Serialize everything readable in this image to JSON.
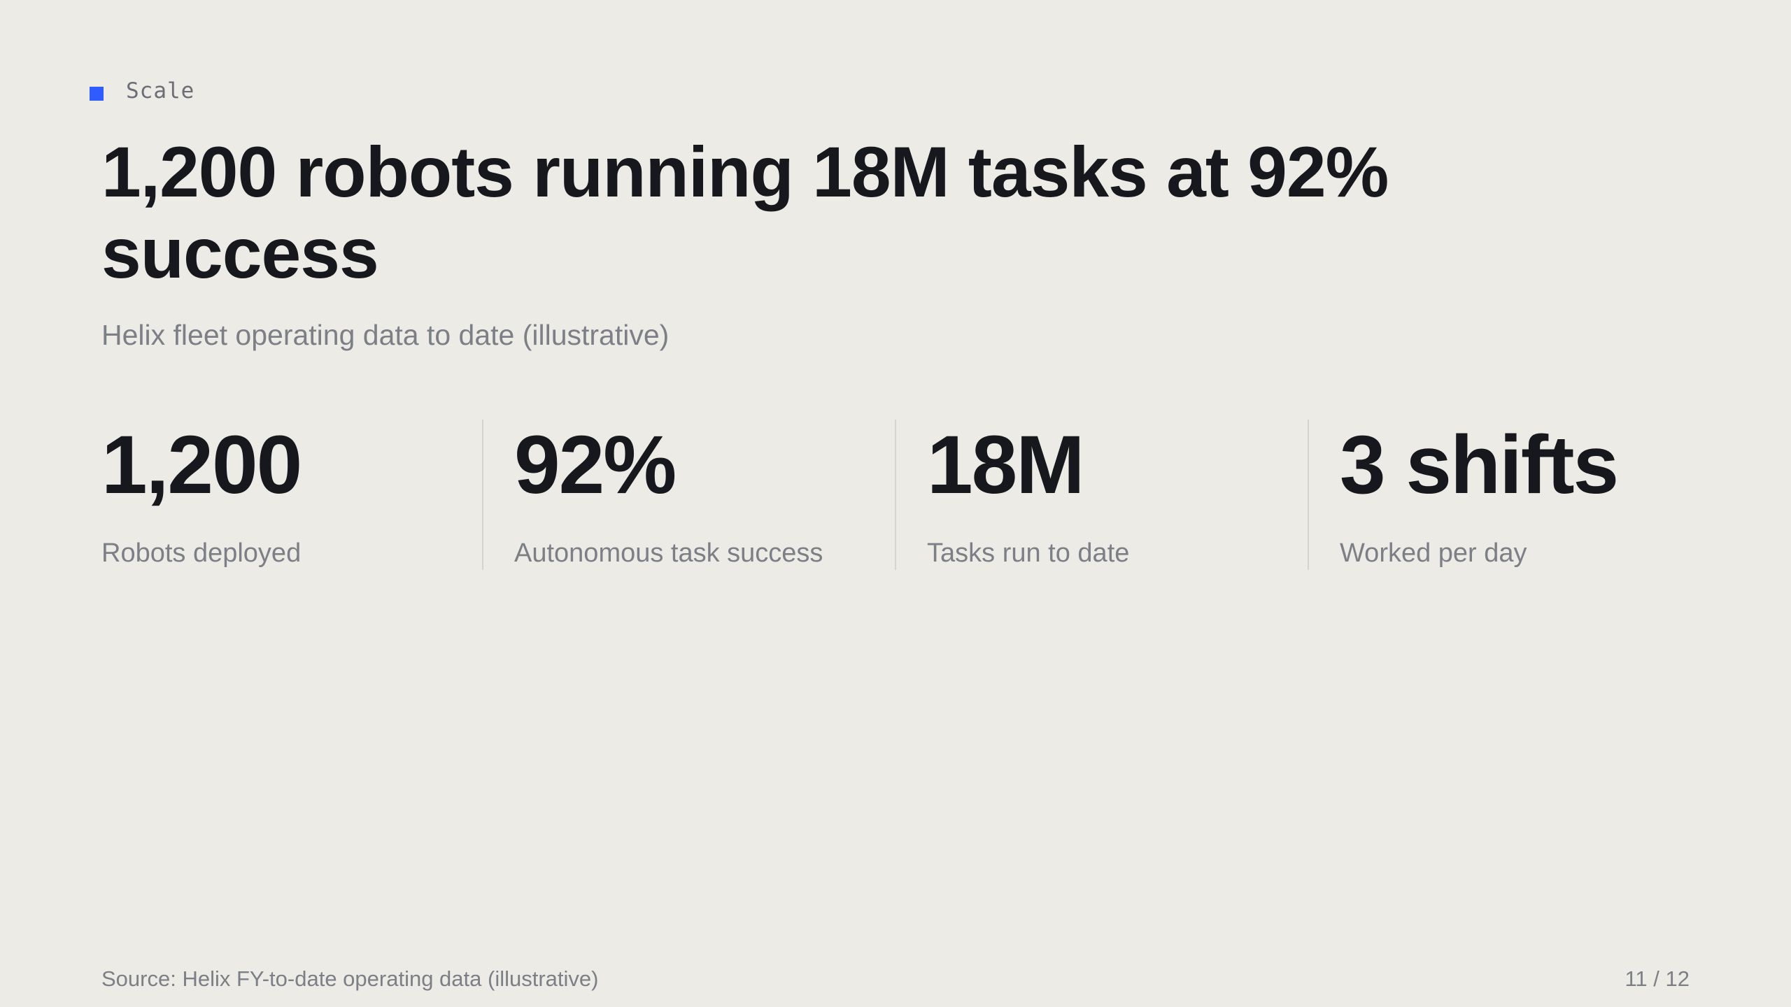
{
  "kicker": {
    "label": "Scale"
  },
  "title": "1,200 robots running 18M tasks at 92% success",
  "subtitle": "Helix fleet operating data to date (illustrative)",
  "stats": [
    {
      "value": "1,200",
      "label": "Robots deployed"
    },
    {
      "value": "92%",
      "label": "Autonomous task success"
    },
    {
      "value": "18M",
      "label": "Tasks run to date"
    },
    {
      "value": "3 shifts",
      "label": "Worked per day"
    }
  ],
  "footer": {
    "source": "Source: Helix FY-to-date operating data (illustrative)",
    "page": "11 / 12"
  },
  "colors": {
    "accent": "#2f5bff",
    "background": "#edebe6",
    "text": "#16181d",
    "muted": "#7c7f86"
  }
}
